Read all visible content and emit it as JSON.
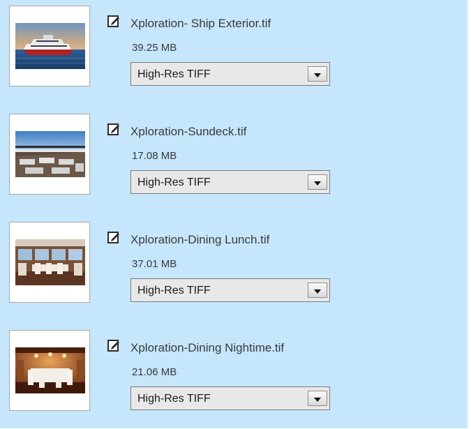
{
  "files": [
    {
      "filename": "Xploration- Ship Exterior.tif",
      "size": "39.25 MB",
      "format": "High-Res TIFF"
    },
    {
      "filename": "Xploration-Sundeck.tif",
      "size": "17.08 MB",
      "format": "High-Res TIFF"
    },
    {
      "filename": "Xploration-Dining Lunch.tif",
      "size": "37.01 MB",
      "format": "High-Res TIFF"
    },
    {
      "filename": "Xploration-Dining Nightime.tif",
      "size": "21.06 MB",
      "format": "High-Res TIFF"
    }
  ],
  "colors": {
    "panel_background": "#c5e6fb",
    "dropdown_background": "#e8e8e8"
  },
  "icons": {
    "edit": "edit-icon",
    "dropdown": "chevron-down-icon"
  }
}
